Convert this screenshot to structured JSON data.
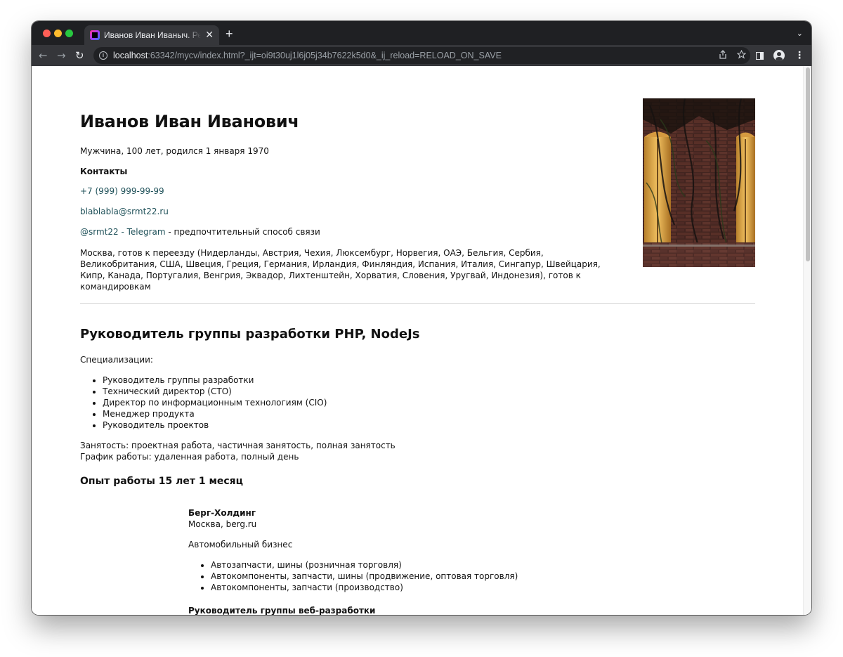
{
  "browser": {
    "tab_title": "Иванов Иван Иваныч. Резюме",
    "url_host": "localhost",
    "url_rest": ":63342/mycv/index.html?_ijt=oi9t30uj1l6j05j34b7622k5d0&_ij_reload=RELOAD_ON_SAVE",
    "icons": [
      "close-icon",
      "new-tab-icon",
      "tab-list-icon",
      "back-icon",
      "forward-icon",
      "reload-icon",
      "info-icon",
      "share-icon",
      "star-icon",
      "side-panel-icon",
      "profile-icon",
      "menu-icon"
    ]
  },
  "resume": {
    "name": "Иванов Иван Иванович",
    "bio": "Мужчина, 100 лет, родился 1 января 1970",
    "contacts_heading": "Контакты",
    "phone": "+7 (999) 999-99-99",
    "email": "blablabla@srmt22.ru",
    "telegram_link": "@srmt22 - Telegram",
    "telegram_note": " - предпочтительный способ связи",
    "address": "Москва, готов к переезду (Нидерланды, Австрия, Чехия, Люксембург, Норвегия, ОАЭ, Бельгия, Сербия, Великобритания, США, Швеция, Греция, Германия, Ирландия, Финляндия, Испания, Италия, Сингапур, Швейцария, Кипр, Канада, Португалия, Венгрия, Эквадор, Лихтенштейн, Хорватия, Словения, Уругвай, Индонезия), готов к командировкам",
    "position": "Руководитель группы разработки PHP, NodeJs",
    "spec_label": "Специализации:",
    "specializations": [
      "Руководитель группы разработки",
      "Технический директор (CTO)",
      "Директор по информационным технологиям (CIO)",
      "Менеджер продукта",
      "Руководитель проектов"
    ],
    "employment": "Занятость: проектная работа, частичная занятость, полная занятость",
    "schedule": "График работы: удаленная работа, полный день",
    "experience_title": "Опыт работы 15 лет 1 месяц",
    "company": {
      "name": "Берг-Холдинг",
      "location": "Москва, berg.ru",
      "industry": "Автомобильный бизнес",
      "areas": [
        "Автозапчасти, шины (розничная торговля)",
        "Автокомпоненты, запчасти, шины (продвижение, оптовая торговля)",
        "Автокомпоненты, запчасти (производство)"
      ],
      "role": "Руководитель группы веб-разработки"
    }
  }
}
